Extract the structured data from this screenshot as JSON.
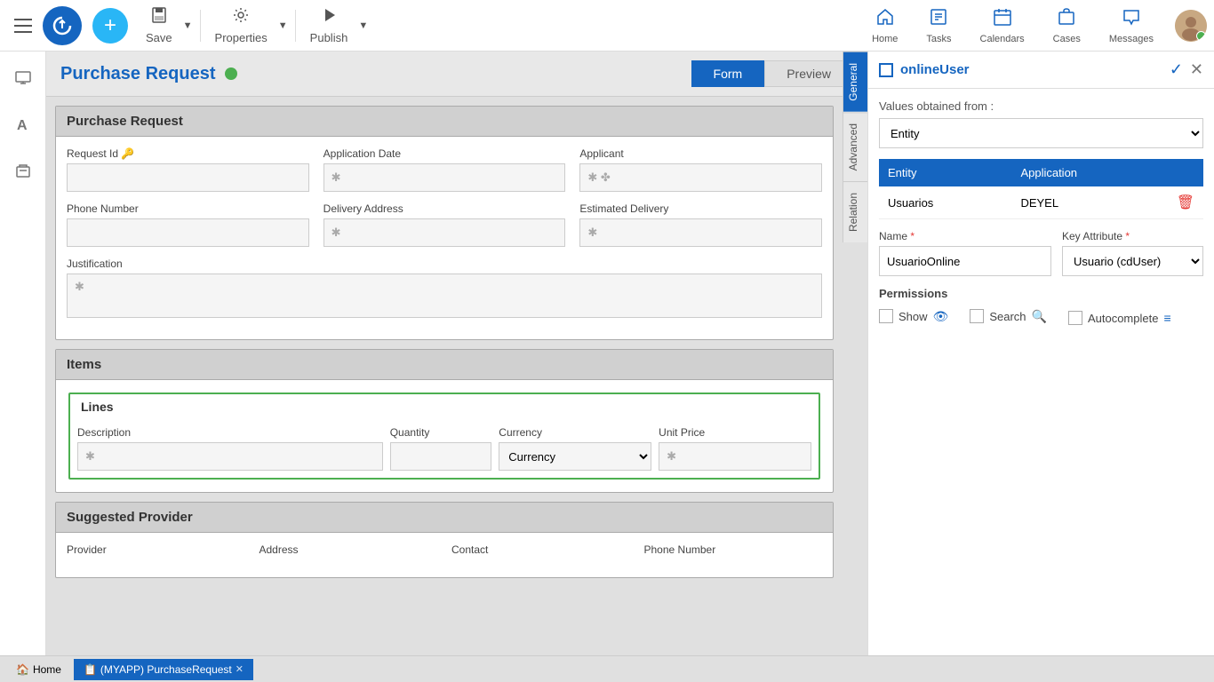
{
  "toolbar": {
    "save_label": "Save",
    "properties_label": "Properties",
    "publish_label": "Publish"
  },
  "nav": {
    "home_label": "Home",
    "tasks_label": "Tasks",
    "calendars_label": "Calendars",
    "cases_label": "Cases",
    "messages_label": "Messages"
  },
  "page": {
    "title": "Purchase Request",
    "form_tab": "Form",
    "preview_tab": "Preview"
  },
  "sections": {
    "purchase_request": {
      "header": "Purchase Request",
      "request_id_label": "Request Id",
      "application_date_label": "Application Date",
      "applicant_label": "Applicant",
      "phone_number_label": "Phone Number",
      "delivery_address_label": "Delivery Address",
      "estimated_delivery_label": "Estimated Delivery",
      "justification_label": "Justification"
    },
    "items": {
      "header": "Items",
      "lines_header": "Lines",
      "description_label": "Description",
      "quantity_label": "Quantity",
      "currency_label": "Currency",
      "currency_default": "Currency",
      "unit_price_label": "Unit Price"
    },
    "suggested_provider": {
      "header": "Suggested Provider",
      "provider_label": "Provider",
      "address_label": "Address",
      "contact_label": "Contact",
      "phone_label": "Phone Number"
    }
  },
  "vertical_tabs": {
    "general": "General",
    "advanced": "Advanced",
    "relation": "Relation"
  },
  "right_panel": {
    "title": "onlineUser",
    "values_from_label": "Values obtained from :",
    "entity_option": "Entity",
    "table_headers": {
      "entity": "Entity",
      "application": "Application"
    },
    "table_rows": [
      {
        "entity": "Usuarios",
        "application": "DEYEL"
      }
    ],
    "name_label": "Name",
    "name_value": "UsuarioOnline",
    "key_attr_label": "Key Attribute",
    "key_attr_value": "Usuario (cdUser)",
    "permissions_label": "Permissions",
    "show_label": "Show",
    "search_label": "Search",
    "autocomplete_label": "Autocomplete"
  },
  "bottom_bar": {
    "home_label": "Home",
    "tab_label": "(MYAPP) PurchaseRequest"
  }
}
